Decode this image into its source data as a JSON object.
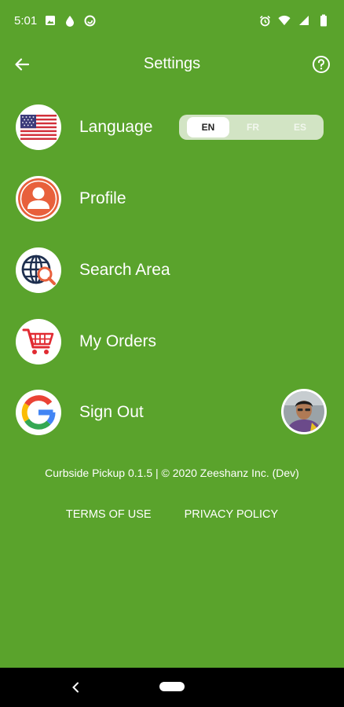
{
  "status": {
    "time": "5:01",
    "left_icons": [
      "image-icon",
      "water-drop-icon",
      "sync-icon"
    ],
    "right_icons": [
      "alarm-icon",
      "wifi-icon",
      "signal-icon",
      "battery-icon"
    ]
  },
  "appbar": {
    "title": "Settings",
    "back_icon": "arrow-back-icon",
    "help_icon": "help-circle-icon"
  },
  "menu": {
    "language": {
      "label": "Language",
      "icon": "us-flag-icon",
      "options": [
        "EN",
        "FR",
        "ES"
      ],
      "selected": "EN"
    },
    "profile": {
      "label": "Profile",
      "icon": "person-icon"
    },
    "search_area": {
      "label": "Search Area",
      "icon": "globe-search-icon"
    },
    "orders": {
      "label": "My Orders",
      "icon": "cart-icon"
    },
    "signout": {
      "label": "Sign Out",
      "icon": "google-icon"
    }
  },
  "footer": {
    "version": "Curbside Pickup 0.1.5 | © 2020 Zeeshanz Inc. (Dev)",
    "terms": "TERMS OF USE",
    "privacy": "PRIVACY POLICY"
  },
  "colors": {
    "background": "#5aa32c",
    "profile_orange": "#e8603c",
    "cart_red": "#e12b32"
  }
}
